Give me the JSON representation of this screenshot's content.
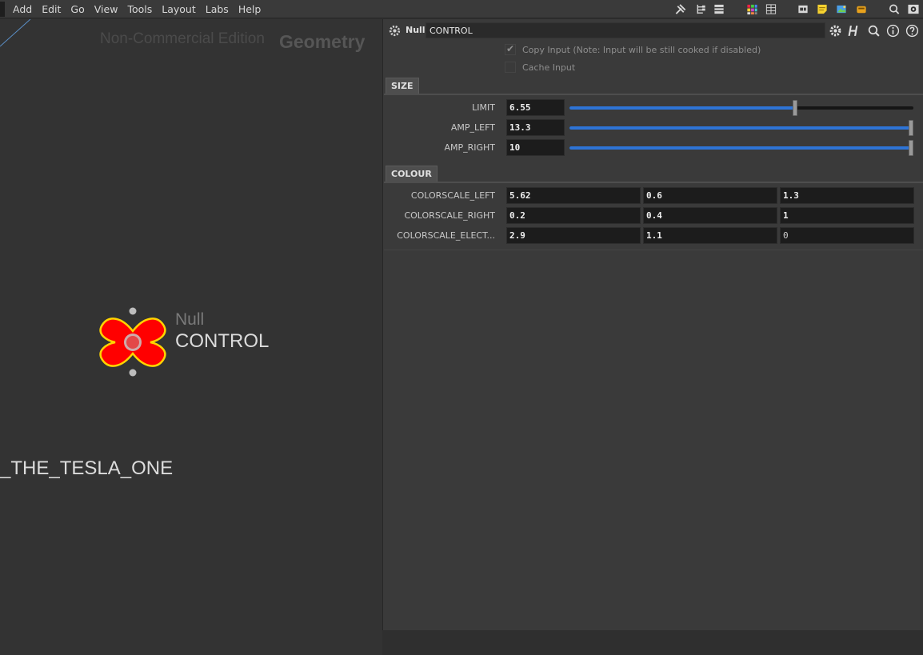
{
  "menu": {
    "items": [
      "Add",
      "Edit",
      "Go",
      "View",
      "Tools",
      "Layout",
      "Labs",
      "Help"
    ]
  },
  "toolbar_icons": [
    "tools-icon",
    "tree-icon",
    "list-icon",
    "palette-grid-icon",
    "grid-icon",
    "network-box-icon",
    "sticky-note-icon",
    "image-icon",
    "dock-icon",
    "search-icon",
    "eye-icon"
  ],
  "network": {
    "edition": "Non-Commercial Edition",
    "context": "Geometry",
    "node": {
      "type": "Null",
      "name": "CONTROL",
      "color": "#ff0000"
    },
    "other_node_name": "_THE_TESLA_ONE"
  },
  "params": {
    "node_type": "Null",
    "node_name": "CONTROL",
    "header_icons": [
      "gear-icon",
      "houdini-help-icon",
      "search-icon",
      "info-icon",
      "help-icon"
    ],
    "copy_input": {
      "label": "Copy Input (Note: Input will be still cooked if disabled)",
      "checked": true
    },
    "cache_input": {
      "label": "Cache Input",
      "checked": false
    },
    "size": {
      "tab": "SIZE",
      "rows": [
        {
          "label": "LIMIT",
          "value": "6.55",
          "fill": 0.655
        },
        {
          "label": "AMP_LEFT",
          "value": "13.3",
          "fill": 1.0
        },
        {
          "label": "AMP_RIGHT",
          "value": "10",
          "fill": 1.0
        }
      ]
    },
    "colour": {
      "tab": "COLOUR",
      "rows": [
        {
          "label": "COLORSCALE_LEFT",
          "values": [
            "5.62",
            "0.6",
            "1.3"
          ]
        },
        {
          "label": "COLORSCALE_RIGHT",
          "values": [
            "0.2",
            "0.4",
            "1"
          ]
        },
        {
          "label": "COLORSCALE_ELECT...",
          "values": [
            "2.9",
            "1.1",
            "0"
          ]
        }
      ]
    },
    "accent_color": "#2e74d6"
  }
}
